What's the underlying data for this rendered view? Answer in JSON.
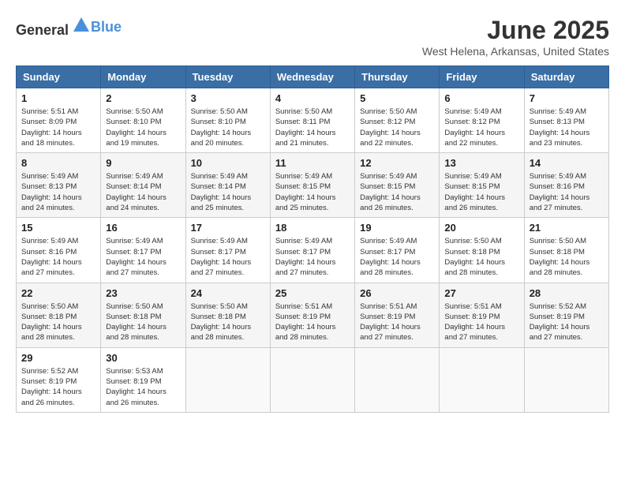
{
  "header": {
    "logo_general": "General",
    "logo_blue": "Blue",
    "month_title": "June 2025",
    "location": "West Helena, Arkansas, United States"
  },
  "days_of_week": [
    "Sunday",
    "Monday",
    "Tuesday",
    "Wednesday",
    "Thursday",
    "Friday",
    "Saturday"
  ],
  "weeks": [
    [
      {
        "day": "1",
        "sunrise": "5:51 AM",
        "sunset": "8:09 PM",
        "daylight": "14 hours and 18 minutes."
      },
      {
        "day": "2",
        "sunrise": "5:50 AM",
        "sunset": "8:10 PM",
        "daylight": "14 hours and 19 minutes."
      },
      {
        "day": "3",
        "sunrise": "5:50 AM",
        "sunset": "8:10 PM",
        "daylight": "14 hours and 20 minutes."
      },
      {
        "day": "4",
        "sunrise": "5:50 AM",
        "sunset": "8:11 PM",
        "daylight": "14 hours and 21 minutes."
      },
      {
        "day": "5",
        "sunrise": "5:50 AM",
        "sunset": "8:12 PM",
        "daylight": "14 hours and 22 minutes."
      },
      {
        "day": "6",
        "sunrise": "5:49 AM",
        "sunset": "8:12 PM",
        "daylight": "14 hours and 22 minutes."
      },
      {
        "day": "7",
        "sunrise": "5:49 AM",
        "sunset": "8:13 PM",
        "daylight": "14 hours and 23 minutes."
      }
    ],
    [
      {
        "day": "8",
        "sunrise": "5:49 AM",
        "sunset": "8:13 PM",
        "daylight": "14 hours and 24 minutes."
      },
      {
        "day": "9",
        "sunrise": "5:49 AM",
        "sunset": "8:14 PM",
        "daylight": "14 hours and 24 minutes."
      },
      {
        "day": "10",
        "sunrise": "5:49 AM",
        "sunset": "8:14 PM",
        "daylight": "14 hours and 25 minutes."
      },
      {
        "day": "11",
        "sunrise": "5:49 AM",
        "sunset": "8:15 PM",
        "daylight": "14 hours and 25 minutes."
      },
      {
        "day": "12",
        "sunrise": "5:49 AM",
        "sunset": "8:15 PM",
        "daylight": "14 hours and 26 minutes."
      },
      {
        "day": "13",
        "sunrise": "5:49 AM",
        "sunset": "8:15 PM",
        "daylight": "14 hours and 26 minutes."
      },
      {
        "day": "14",
        "sunrise": "5:49 AM",
        "sunset": "8:16 PM",
        "daylight": "14 hours and 27 minutes."
      }
    ],
    [
      {
        "day": "15",
        "sunrise": "5:49 AM",
        "sunset": "8:16 PM",
        "daylight": "14 hours and 27 minutes."
      },
      {
        "day": "16",
        "sunrise": "5:49 AM",
        "sunset": "8:17 PM",
        "daylight": "14 hours and 27 minutes."
      },
      {
        "day": "17",
        "sunrise": "5:49 AM",
        "sunset": "8:17 PM",
        "daylight": "14 hours and 27 minutes."
      },
      {
        "day": "18",
        "sunrise": "5:49 AM",
        "sunset": "8:17 PM",
        "daylight": "14 hours and 27 minutes."
      },
      {
        "day": "19",
        "sunrise": "5:49 AM",
        "sunset": "8:17 PM",
        "daylight": "14 hours and 28 minutes."
      },
      {
        "day": "20",
        "sunrise": "5:50 AM",
        "sunset": "8:18 PM",
        "daylight": "14 hours and 28 minutes."
      },
      {
        "day": "21",
        "sunrise": "5:50 AM",
        "sunset": "8:18 PM",
        "daylight": "14 hours and 28 minutes."
      }
    ],
    [
      {
        "day": "22",
        "sunrise": "5:50 AM",
        "sunset": "8:18 PM",
        "daylight": "14 hours and 28 minutes."
      },
      {
        "day": "23",
        "sunrise": "5:50 AM",
        "sunset": "8:18 PM",
        "daylight": "14 hours and 28 minutes."
      },
      {
        "day": "24",
        "sunrise": "5:50 AM",
        "sunset": "8:18 PM",
        "daylight": "14 hours and 28 minutes."
      },
      {
        "day": "25",
        "sunrise": "5:51 AM",
        "sunset": "8:19 PM",
        "daylight": "14 hours and 28 minutes."
      },
      {
        "day": "26",
        "sunrise": "5:51 AM",
        "sunset": "8:19 PM",
        "daylight": "14 hours and 27 minutes."
      },
      {
        "day": "27",
        "sunrise": "5:51 AM",
        "sunset": "8:19 PM",
        "daylight": "14 hours and 27 minutes."
      },
      {
        "day": "28",
        "sunrise": "5:52 AM",
        "sunset": "8:19 PM",
        "daylight": "14 hours and 27 minutes."
      }
    ],
    [
      {
        "day": "29",
        "sunrise": "5:52 AM",
        "sunset": "8:19 PM",
        "daylight": "14 hours and 26 minutes."
      },
      {
        "day": "30",
        "sunrise": "5:53 AM",
        "sunset": "8:19 PM",
        "daylight": "14 hours and 26 minutes."
      },
      null,
      null,
      null,
      null,
      null
    ]
  ]
}
